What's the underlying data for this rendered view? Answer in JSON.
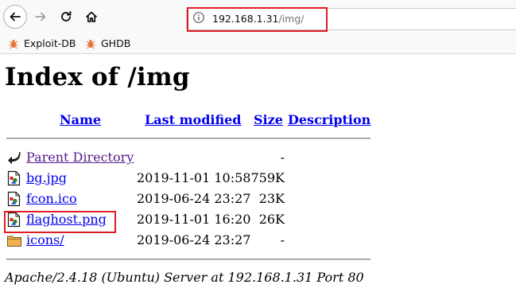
{
  "browser": {
    "url_host": "192.168.1.31",
    "url_path": "/img/",
    "bookmarks": [
      {
        "label": "Exploit-DB",
        "icon": "bug-icon"
      },
      {
        "label": "GHDB",
        "icon": "bug-icon"
      }
    ],
    "nav_icons": [
      "back-arrow-icon",
      "forward-arrow-icon",
      "reload-icon",
      "home-icon",
      "info-icon"
    ]
  },
  "page": {
    "title": "Index of /img",
    "columns": {
      "name": "Name",
      "last_modified": "Last modified",
      "size": "Size",
      "description": "Description"
    },
    "rows": [
      {
        "name": "Parent Directory",
        "modified": "",
        "size": "-",
        "icon": "back-folder-icon"
      },
      {
        "name": "bg.jpg",
        "modified": "2019-11-01 10:58",
        "size": "759K",
        "icon": "image-file-icon"
      },
      {
        "name": "fcon.ico",
        "modified": "2019-06-24 23:27",
        "size": "23K",
        "icon": "image-file-icon"
      },
      {
        "name": "flaghost.png",
        "modified": "2019-11-01 16:20",
        "size": "26K",
        "icon": "image-file-icon"
      },
      {
        "name": "icons/",
        "modified": "2019-06-24 23:27",
        "size": "-",
        "icon": "folder-icon"
      }
    ],
    "footer": "Apache/2.4.18 (Ubuntu) Server at 192.168.1.31 Port 80"
  },
  "colors": {
    "link": "#0000ee",
    "visited": "#551a8b",
    "highlight": "#e01b24"
  }
}
